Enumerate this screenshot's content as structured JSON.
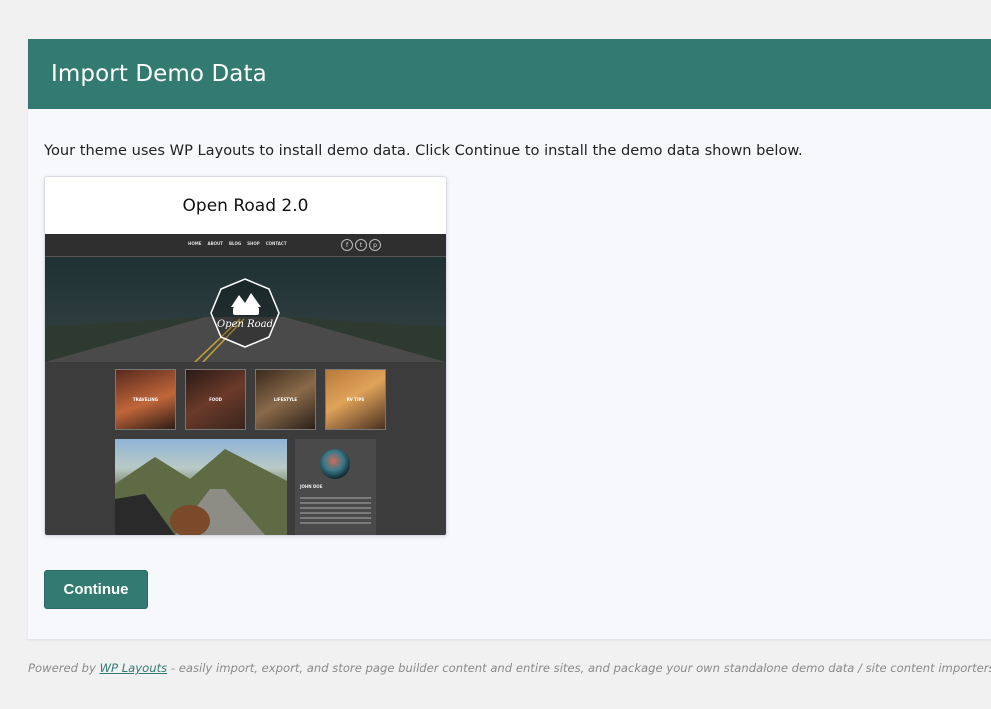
{
  "header": {
    "title": "Import Demo Data"
  },
  "intro": {
    "text": "Your theme uses WP Layouts to install demo data. Click Continue to install the demo data shown below."
  },
  "demo_card": {
    "title": "Open Road 2.0",
    "preview": {
      "nav_links": [
        "HOME",
        "ABOUT",
        "BLOG",
        "SHOP",
        "CONTACT"
      ],
      "social_icons": [
        "facebook-icon",
        "twitter-icon",
        "pinterest-icon"
      ],
      "logo_text": "Open Road",
      "thumbnails": [
        "TRAVELING",
        "FOOD",
        "LIFESTYLE",
        "RV TIPS"
      ],
      "author_name": "JOHN DOE"
    }
  },
  "actions": {
    "continue_label": "Continue"
  },
  "footer": {
    "prefix": "Powered by ",
    "link_text": "WP Layouts",
    "suffix": " - easily import, export, and store page builder content and entire sites, and package your own standalone demo data / site content importers!"
  },
  "colors": {
    "accent": "#337a71",
    "background": "#f1f1f1",
    "panel": "#f7f8fc"
  }
}
